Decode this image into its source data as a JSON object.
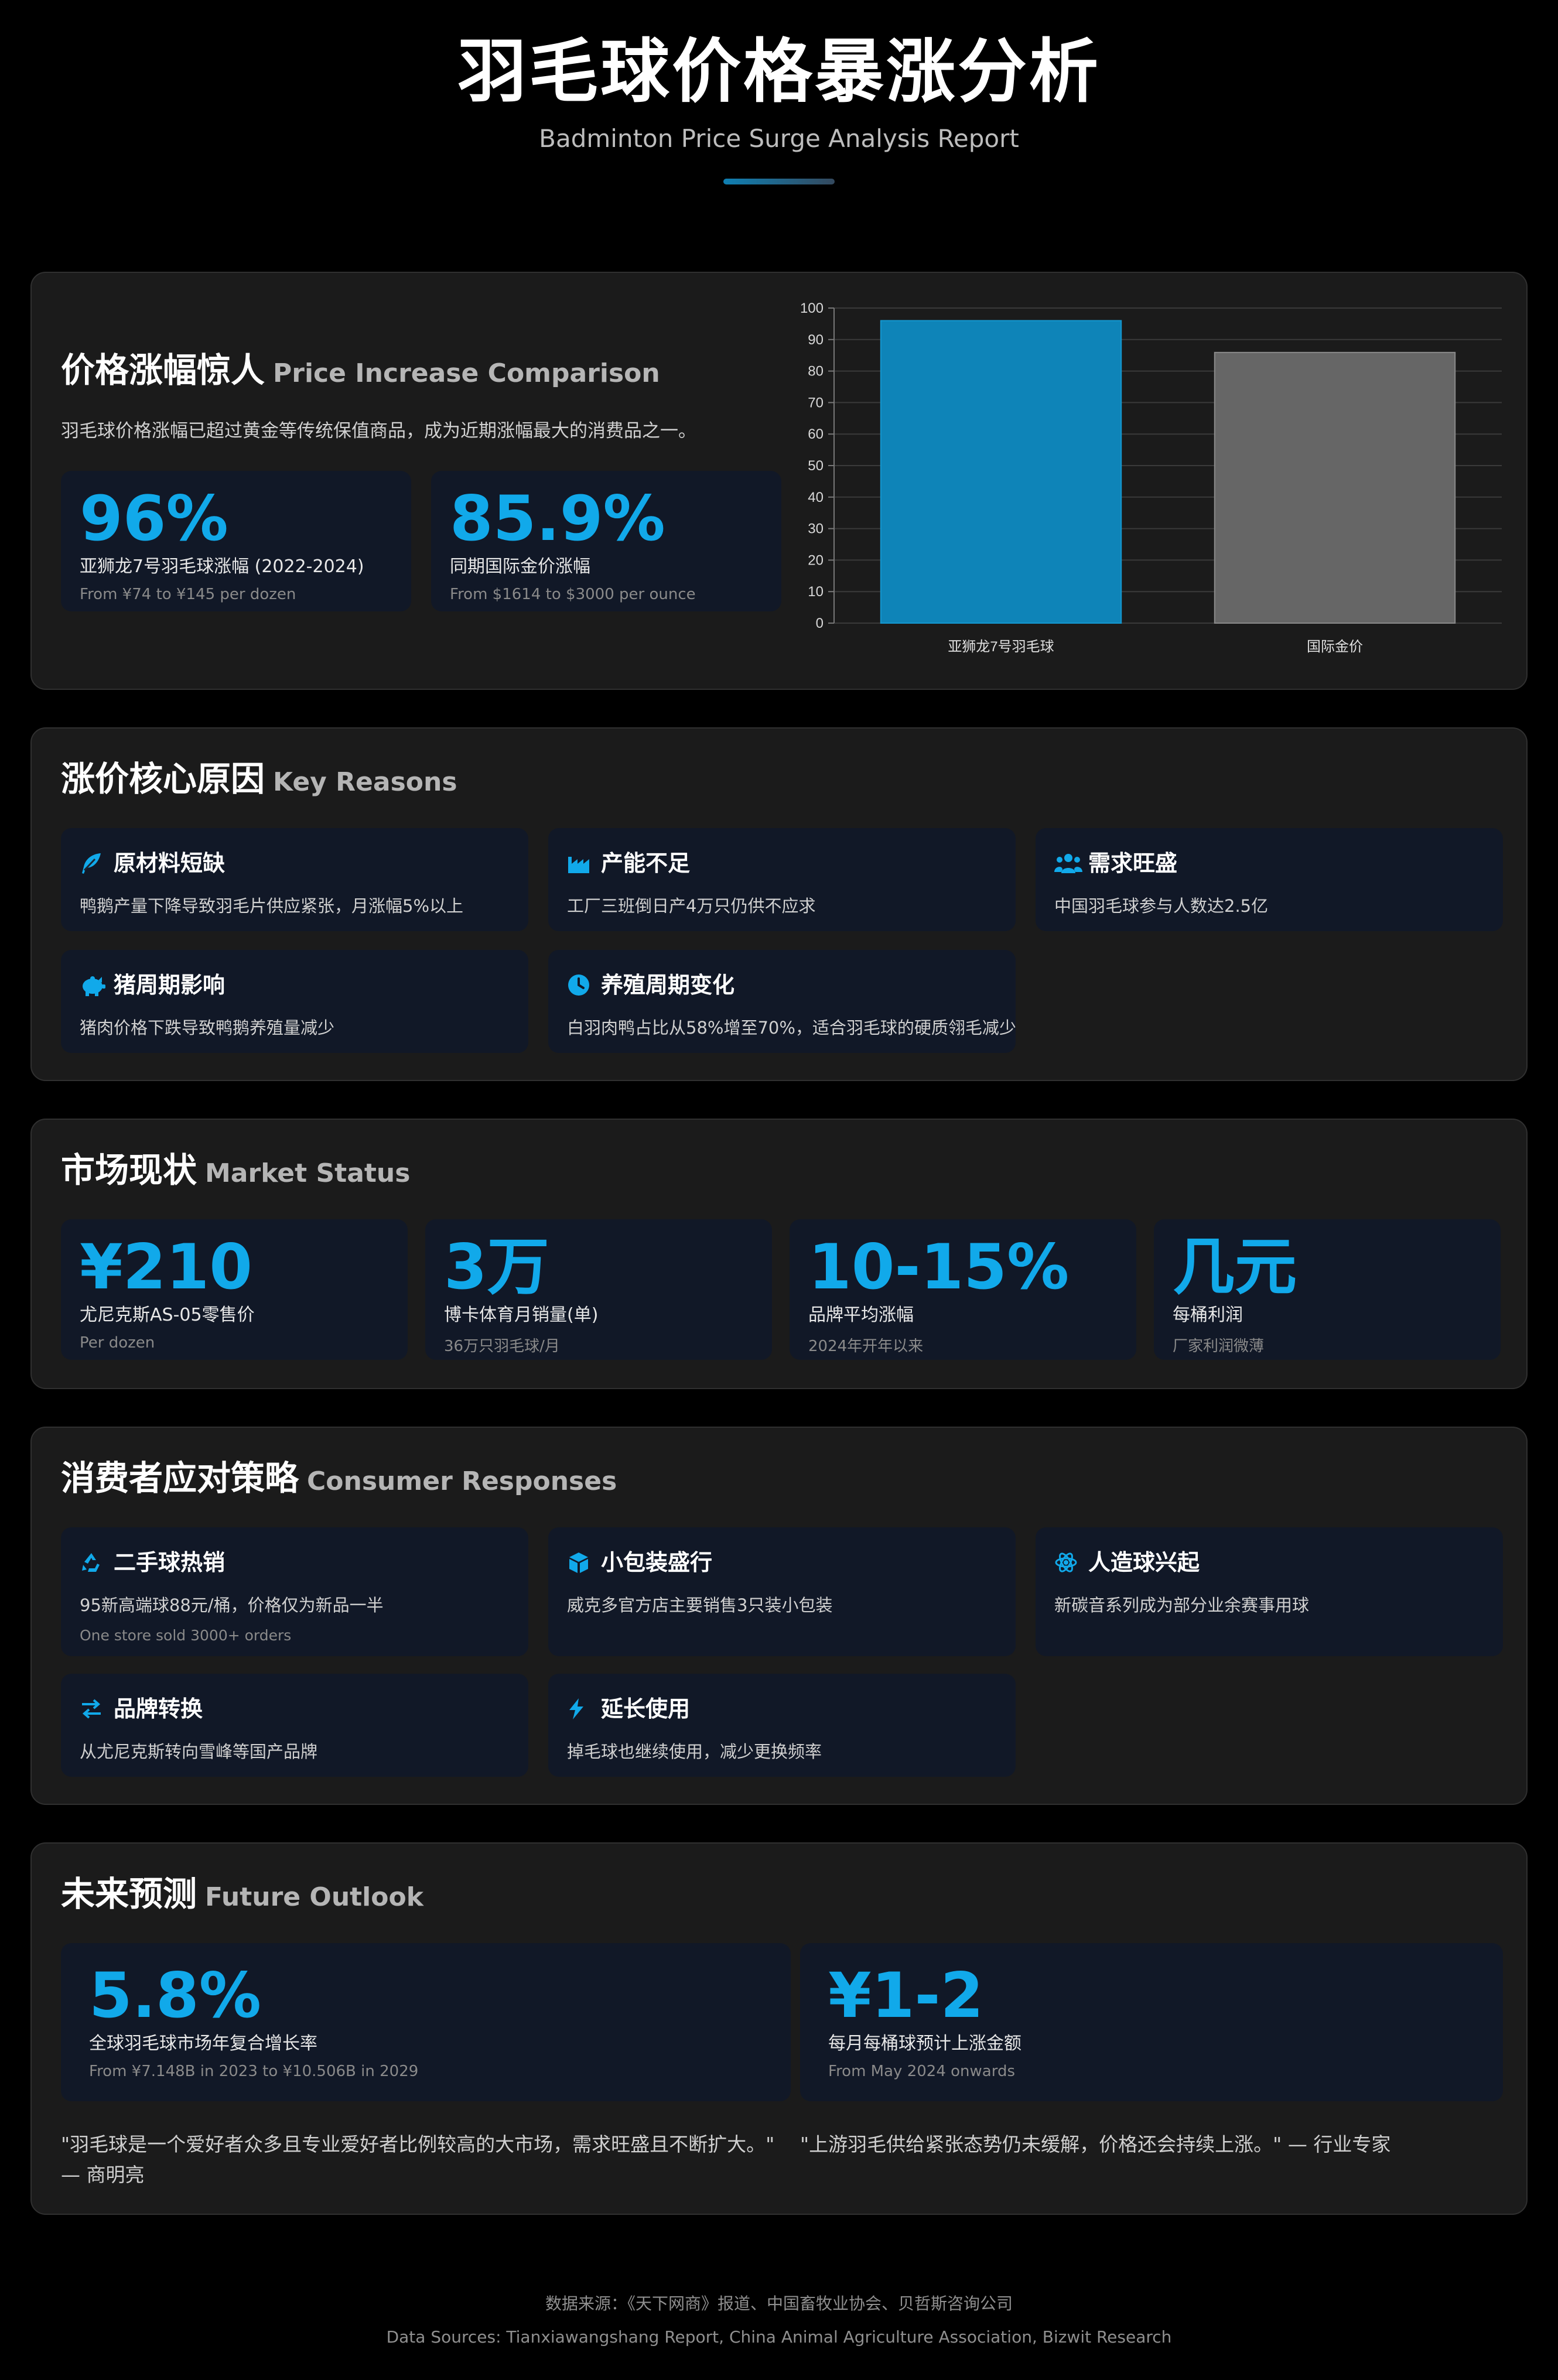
{
  "header": {
    "title": "羽毛球价格暴涨分析",
    "subtitle": "Badminton Price Surge Analysis Report"
  },
  "comparison": {
    "title_cn": "价格涨幅惊人",
    "title_en": "Price Increase Comparison",
    "intro": "羽毛球价格涨幅已超过黄金等传统保值商品，成为近期涨幅最大的消费品之一。",
    "stats": [
      {
        "value": "96%",
        "label": "亚狮龙7号羽毛球涨幅 (2022-2024)",
        "note": "From ¥74 to ¥145 per dozen"
      },
      {
        "value": "85.9%",
        "label": "同期国际金价涨幅",
        "note": "From $1614 to $3000 per ounce"
      }
    ]
  },
  "chart_data": {
    "type": "bar",
    "categories": [
      "亚狮龙7号羽毛球",
      "国际金价"
    ],
    "values": [
      96,
      85.9
    ],
    "colors": [
      "#0e84b8",
      "#666666"
    ],
    "ylim": [
      0,
      100
    ],
    "yticks": [
      0,
      10,
      20,
      30,
      40,
      50,
      60,
      70,
      80,
      90,
      100
    ],
    "grid": true
  },
  "reasons": {
    "title_cn": "涨价核心原因",
    "title_en": "Key Reasons",
    "items": [
      {
        "icon": "feather-icon",
        "title": "原材料短缺",
        "desc": "鸭鹅产量下降导致羽毛片供应紧张，月涨幅5%以上"
      },
      {
        "icon": "factory-icon",
        "title": "产能不足",
        "desc": "工厂三班倒日产4万只仍供不应求"
      },
      {
        "icon": "users-icon",
        "title": "需求旺盛",
        "desc": "中国羽毛球参与人数达2.5亿"
      },
      {
        "icon": "piggy-bank-icon",
        "title": "猪周期影响",
        "desc": "猪肉价格下跌导致鸭鹅养殖量减少"
      },
      {
        "icon": "clock-icon",
        "title": "养殖周期变化",
        "desc": "白羽肉鸭占比从58%增至70%，适合羽毛球的硬质翎毛减少"
      }
    ]
  },
  "market": {
    "title_cn": "市场现状",
    "title_en": "Market Status",
    "stats": [
      {
        "value": "¥210",
        "label": "尤尼克斯AS-05零售价",
        "note": "Per dozen"
      },
      {
        "value": "3万",
        "label": "博卡体育月销量(单)",
        "note": "36万只羽毛球/月"
      },
      {
        "value": "10-15%",
        "label": "品牌平均涨幅",
        "note": "2024年开年以来"
      },
      {
        "value": "几元",
        "label": "每桶利润",
        "note": "厂家利润微薄"
      }
    ]
  },
  "responses": {
    "title_cn": "消费者应对策略",
    "title_en": "Consumer Responses",
    "items": [
      {
        "icon": "recycle-icon",
        "title": "二手球热销",
        "desc": "95新高端球88元/桶，价格仅为新品一半",
        "note": "One store sold 3000+ orders"
      },
      {
        "icon": "box-icon",
        "title": "小包装盛行",
        "desc": "威克多官方店主要销售3只装小包装",
        "note": ""
      },
      {
        "icon": "atom-icon",
        "title": "人造球兴起",
        "desc": "新碳音系列成为部分业余赛事用球",
        "note": ""
      },
      {
        "icon": "exchange-icon",
        "title": "品牌转换",
        "desc": "从尤尼克斯转向雪峰等国产品牌",
        "note": ""
      },
      {
        "icon": "bolt-icon",
        "title": "延长使用",
        "desc": "掉毛球也继续使用，减少更换频率",
        "note": ""
      }
    ]
  },
  "outlook": {
    "title_cn": "未来预测",
    "title_en": "Future Outlook",
    "stats": [
      {
        "value": "5.8%",
        "label": "全球羽毛球市场年复合增长率",
        "note": "From ¥7.148B in 2023 to ¥10.506B in 2029"
      },
      {
        "value": "¥1-2",
        "label": "每月每桶球预计上涨金额",
        "note": "From May 2024 onwards"
      }
    ],
    "quotes": [
      {
        "line1": "\"羽毛球是一个爱好者众多且专业爱好者比例较高的大市场，需求旺盛且不断扩大。\"",
        "line2": "— 商明亮"
      },
      {
        "line1": "\"上游羽毛供给紧张态势仍未缓解，价格还会持续上涨。\" — 行业专家",
        "line2": ""
      }
    ]
  },
  "footer": {
    "cn": "数据来源：《天下网商》报道、中国畜牧业协会、贝哲斯咨询公司",
    "en": "Data Sources: Tianxiawangshang Report, China Animal Agriculture Association, Bizwit Research"
  },
  "colors": {
    "accent": "#11a9ea",
    "card_bg": "#111827",
    "section_bg": "#1b1b1b",
    "page_bg": "#000000"
  }
}
